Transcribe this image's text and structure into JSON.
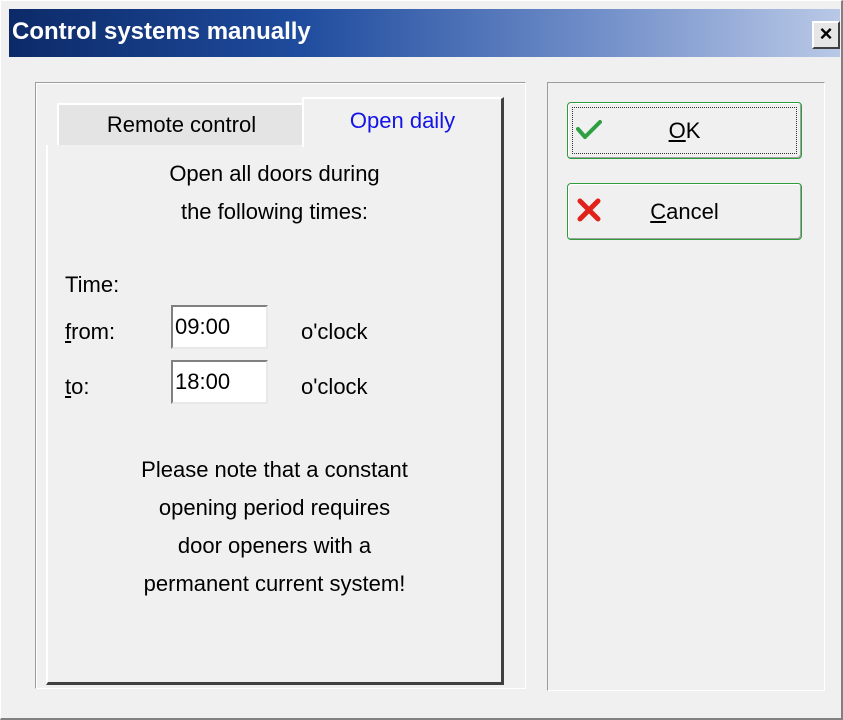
{
  "window": {
    "title": "Control systems manually",
    "close_label": "×"
  },
  "tabs": [
    {
      "label": "Remote control",
      "active": false
    },
    {
      "label": "Open daily",
      "active": true
    }
  ],
  "panel": {
    "intro_line1": "Open all doors during",
    "intro_line2": "the following times:",
    "time_label": "Time:",
    "from_label_accel": "f",
    "from_label_rest": "rom:",
    "to_label_accel": "t",
    "to_label_rest": "o:",
    "from_value": "09:00",
    "to_value": "18:00",
    "unit": "o'clock",
    "note_line1": "Please note that a constant",
    "note_line2": "opening period requires",
    "note_line3": "door openers with a",
    "note_line4": "permanent current system!"
  },
  "buttons": {
    "ok_accel": "O",
    "ok_rest": "K",
    "cancel_accel": "C",
    "cancel_rest": "ancel"
  },
  "colors": {
    "active_tab_text": "#1414e6",
    "ok_icon": "#2ea043",
    "cancel_icon": "#e0221b",
    "button_border": "#2e9c3a"
  },
  "icons": {
    "ok": "checkmark-icon",
    "cancel": "x-icon",
    "close": "close-icon"
  }
}
